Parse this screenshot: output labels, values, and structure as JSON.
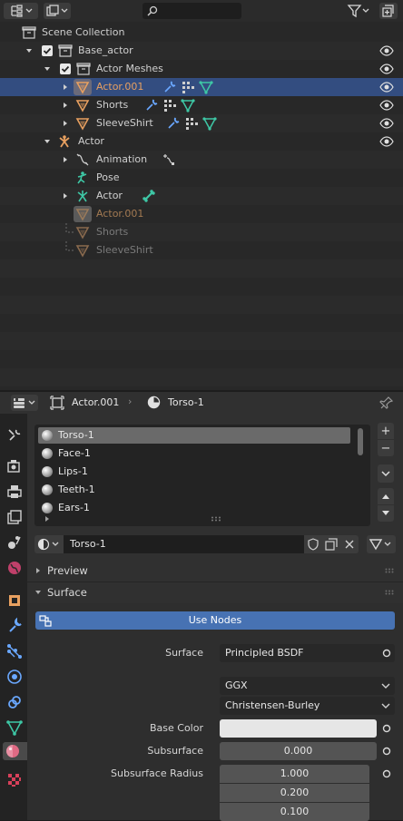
{
  "outliner": {
    "rows": [
      {
        "label": "Scene Collection"
      },
      {
        "label": "Base_actor"
      },
      {
        "label": "Actor Meshes"
      },
      {
        "label": "Actor.001"
      },
      {
        "label": "Shorts"
      },
      {
        "label": "SleeveShirt"
      },
      {
        "label": "Actor"
      },
      {
        "label": "Animation"
      },
      {
        "label": "Pose"
      },
      {
        "label": "Actor"
      },
      {
        "label": "Actor.001"
      },
      {
        "label": "Shorts"
      },
      {
        "label": "SleeveShirt"
      }
    ]
  },
  "properties": {
    "breadcrumb": {
      "object": "Actor.001",
      "material": "Torso-1"
    },
    "material_slots": [
      "Torso-1",
      "Face-1",
      "Lips-1",
      "Teeth-1",
      "Ears-1"
    ],
    "selected_slot": "Torso-1",
    "material_name": "Torso-1",
    "panels": {
      "preview": "Preview",
      "surface": "Surface"
    },
    "use_nodes": "Use Nodes",
    "surface": {
      "surface_label": "Surface",
      "surface_value": "Principled BSDF",
      "distribution": "GGX",
      "subsurface_method": "Christensen-Burley",
      "base_color_label": "Base Color",
      "base_color": "#e6e6e6",
      "subsurface_label": "Subsurface",
      "subsurface_value": "0.000",
      "radius_label": "Subsurface Radius",
      "radius": [
        "1.000",
        "0.200",
        "0.100"
      ]
    }
  },
  "colors": {
    "selection": "#334d80",
    "accent_blue": "#4772b3",
    "orange": "#e8a060",
    "green": "#3ec8a6"
  }
}
